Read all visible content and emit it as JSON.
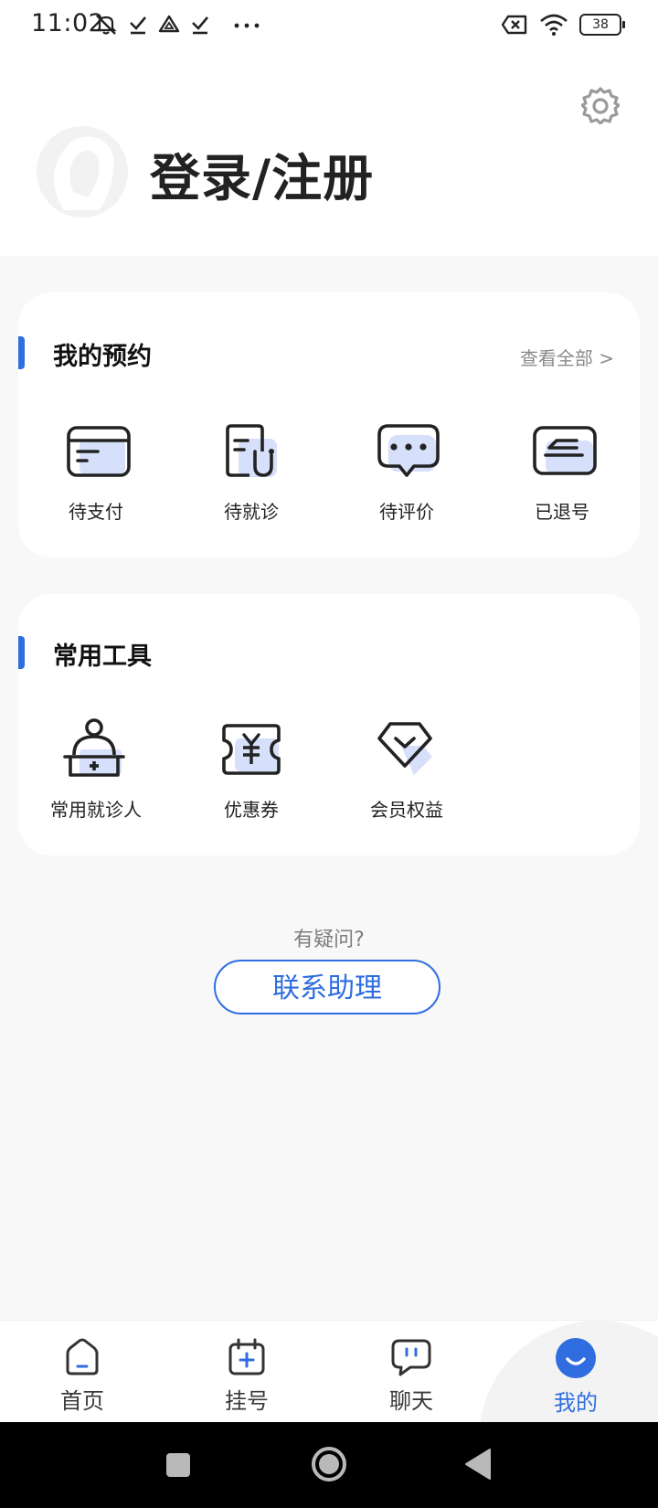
{
  "status_bar": {
    "time": "11:02",
    "battery": "38"
  },
  "header": {
    "login_title": "登录/注册"
  },
  "appointments": {
    "title": "我的预约",
    "view_all": "查看全部 >",
    "items": [
      {
        "label": "待支付",
        "icon": "payment-card-icon"
      },
      {
        "label": "待就诊",
        "icon": "stethoscope-icon"
      },
      {
        "label": "待评价",
        "icon": "comment-icon"
      },
      {
        "label": "已退号",
        "icon": "cancel-ticket-icon"
      }
    ]
  },
  "tools": {
    "title": "常用工具",
    "items": [
      {
        "label": "常用就诊人",
        "icon": "patient-icon"
      },
      {
        "label": "优惠券",
        "icon": "coupon-icon"
      },
      {
        "label": "会员权益",
        "icon": "membership-icon"
      }
    ]
  },
  "help": {
    "question": "有疑问?",
    "contact_button": "联系助理"
  },
  "tabbar": {
    "tabs": [
      {
        "label": "首页",
        "icon": "home-icon"
      },
      {
        "label": "挂号",
        "icon": "calendar-plus-icon"
      },
      {
        "label": "聊天",
        "icon": "chat-icon"
      },
      {
        "label": "我的",
        "icon": "smile-icon",
        "active": true
      }
    ]
  },
  "colors": {
    "accent": "#2f6de0",
    "icon_fill": "#d6e0fb",
    "background": "#f8f8f8"
  }
}
